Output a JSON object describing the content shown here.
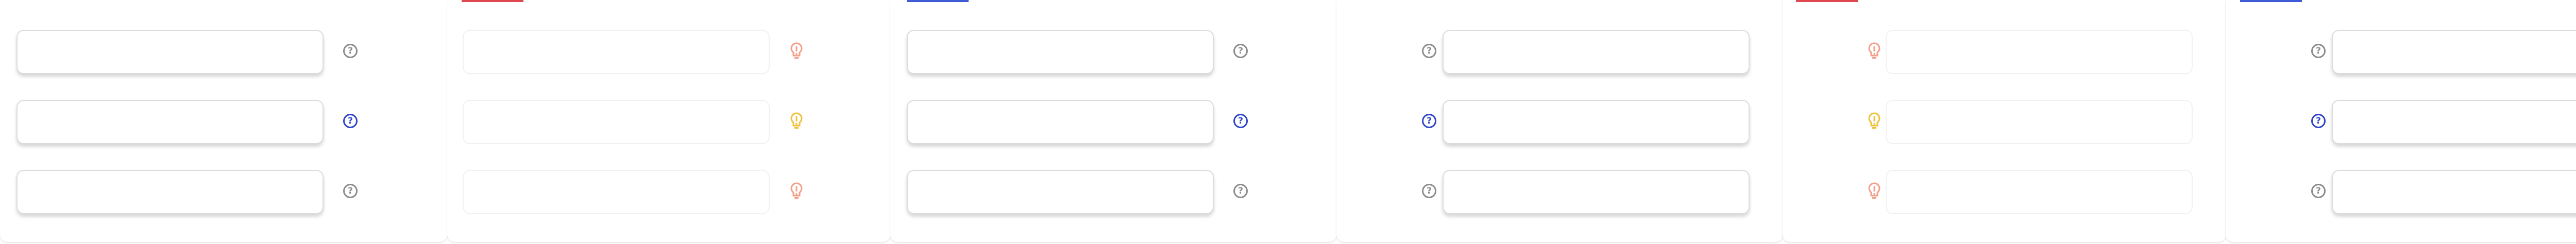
{
  "panels": [
    {
      "name": "panel-1",
      "type": "help",
      "accent": null
    },
    {
      "name": "panel-2",
      "type": "warning",
      "accent": "#e0474f"
    },
    {
      "name": "panel-3",
      "type": "help",
      "accent": "#3f5bd6"
    },
    {
      "name": "panel-4",
      "type": "help-left",
      "accent": null
    },
    {
      "name": "panel-5",
      "type": "warning-left",
      "accent": "#e0474f"
    },
    {
      "name": "panel-6",
      "type": "help-left",
      "accent": "#3f5bd6"
    }
  ],
  "icons": {
    "help_glyph": "?",
    "help_icon": "question-circle-icon",
    "warning_icon": "lightbulb-warning-icon"
  },
  "colors": {
    "help_default": "#8c8c8c",
    "help_active": "#2e45c7",
    "warning_default": "#f2a08a",
    "warning_active": "#f0c23b"
  },
  "fields": [
    {
      "value": "",
      "placeholder": ""
    },
    {
      "value": "",
      "placeholder": ""
    },
    {
      "value": "",
      "placeholder": ""
    }
  ]
}
